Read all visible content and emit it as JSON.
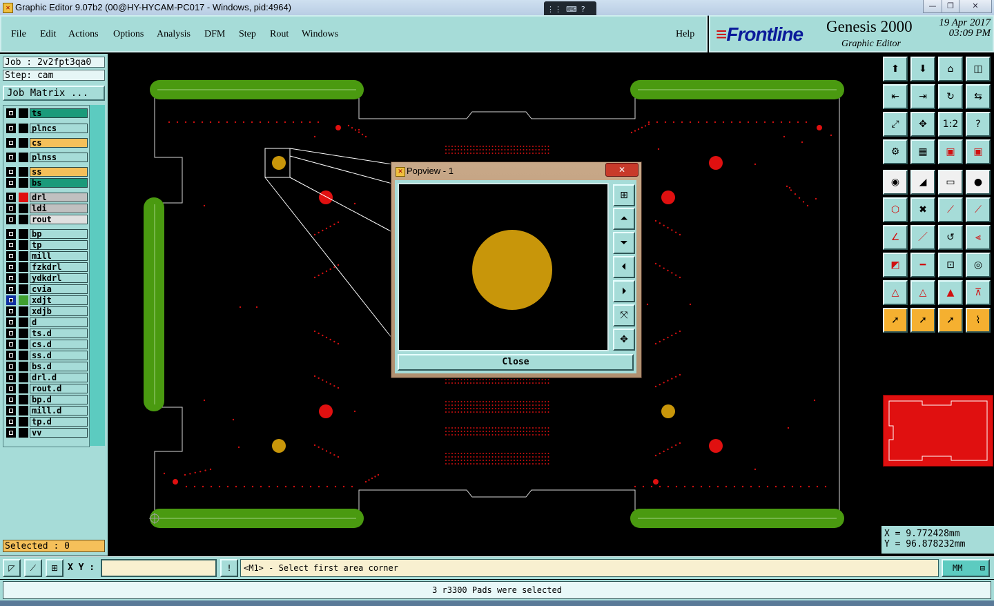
{
  "window": {
    "title": "Graphic Editor 9.07b2 (00@HY-HYCAM-PC017 - Windows, pid:4964)",
    "minimize": "—",
    "restore": "❐",
    "close": "✕"
  },
  "menu": {
    "items": [
      "File",
      "Edit",
      "Actions",
      "Options",
      "Analysis",
      "DFM",
      "Step",
      "Rout",
      "Windows"
    ],
    "help": "Help"
  },
  "brand": {
    "logo_text": "Frontline",
    "product": "Genesis 2000",
    "subtitle": "Graphic Editor",
    "date": "19 Apr 2017",
    "time": "03:09 PM"
  },
  "job": {
    "job_label": "Job : 2v2fpt3qa0",
    "step_label": "Step: cam",
    "matrix_button": "Job Matrix ..."
  },
  "layers": [
    {
      "name": "ts",
      "color": "#1a9a7a",
      "swatch": "#000000",
      "active": false
    },
    {
      "name": "plncs",
      "color": "#a6dcd8",
      "swatch": "#000000",
      "active": false
    },
    {
      "name": "cs",
      "color": "#f5c05a",
      "swatch": "#000000",
      "active": false
    },
    {
      "name": "plnss",
      "color": "#a6dcd8",
      "swatch": "#000000",
      "active": false
    },
    {
      "name": "ss",
      "color": "#f5c05a",
      "swatch": "#000000",
      "active": false
    },
    {
      "name": "bs",
      "color": "#1a9a7a",
      "swatch": "#000000",
      "active": false
    },
    {
      "name": "drl",
      "color": "#c0c0c0",
      "swatch": "#e01010",
      "active": false
    },
    {
      "name": "ldi",
      "color": "#c0c0c0",
      "swatch": "#000000",
      "active": false
    },
    {
      "name": "rout",
      "color": "#e0e0e0",
      "swatch": "#000000",
      "active": false
    },
    {
      "name": "bp",
      "color": "#a6dcd8",
      "swatch": "#000000",
      "active": false
    },
    {
      "name": "tp",
      "color": "#a6dcd8",
      "swatch": "#000000",
      "active": false
    },
    {
      "name": "mill",
      "color": "#a6dcd8",
      "swatch": "#000000",
      "active": false
    },
    {
      "name": "fzkdrl",
      "color": "#a6dcd8",
      "swatch": "#000000",
      "active": false
    },
    {
      "name": "ydkdrl",
      "color": "#a6dcd8",
      "swatch": "#000000",
      "active": false
    },
    {
      "name": "cvia",
      "color": "#a6dcd8",
      "swatch": "#000000",
      "active": false
    },
    {
      "name": "xdjt",
      "color": "#a6dcd8",
      "swatch": "#40a030",
      "active": true
    },
    {
      "name": "xdjb",
      "color": "#a6dcd8",
      "swatch": "#000000",
      "active": false
    },
    {
      "name": "d",
      "color": "#a6dcd8",
      "swatch": "#000000",
      "active": false
    },
    {
      "name": "ts.d",
      "color": "#a6dcd8",
      "swatch": "#000000",
      "active": false
    },
    {
      "name": "cs.d",
      "color": "#a6dcd8",
      "swatch": "#000000",
      "active": false
    },
    {
      "name": "ss.d",
      "color": "#a6dcd8",
      "swatch": "#000000",
      "active": false
    },
    {
      "name": "bs.d",
      "color": "#a6dcd8",
      "swatch": "#000000",
      "active": false
    },
    {
      "name": "drl.d",
      "color": "#a6dcd8",
      "swatch": "#000000",
      "active": false
    },
    {
      "name": "rout.d",
      "color": "#a6dcd8",
      "swatch": "#000000",
      "active": false
    },
    {
      "name": "bp.d",
      "color": "#a6dcd8",
      "swatch": "#000000",
      "active": false
    },
    {
      "name": "mill.d",
      "color": "#a6dcd8",
      "swatch": "#000000",
      "active": false
    },
    {
      "name": "tp.d",
      "color": "#a6dcd8",
      "swatch": "#000000",
      "active": false
    },
    {
      "name": "vv",
      "color": "#a6dcd8",
      "swatch": "#000000",
      "active": false
    }
  ],
  "selected_label": "Selected : 0",
  "popview": {
    "title": "Popview - 1",
    "close_button": "Close"
  },
  "coords": {
    "x": "X = 9.772428mm",
    "y": "Y = 96.878232mm"
  },
  "command": {
    "xy_label": "X Y :",
    "xy_value": "",
    "prompt": "<M1> - Select first area corner",
    "units": "MM",
    "warn_icon": "!"
  },
  "status_message": "3 r3300 Pads were selected",
  "colors": {
    "panel": "#a6dcd8",
    "pad_gold": "#c8960a",
    "drill_red": "#e01010",
    "rail_green": "#4a9a10"
  }
}
